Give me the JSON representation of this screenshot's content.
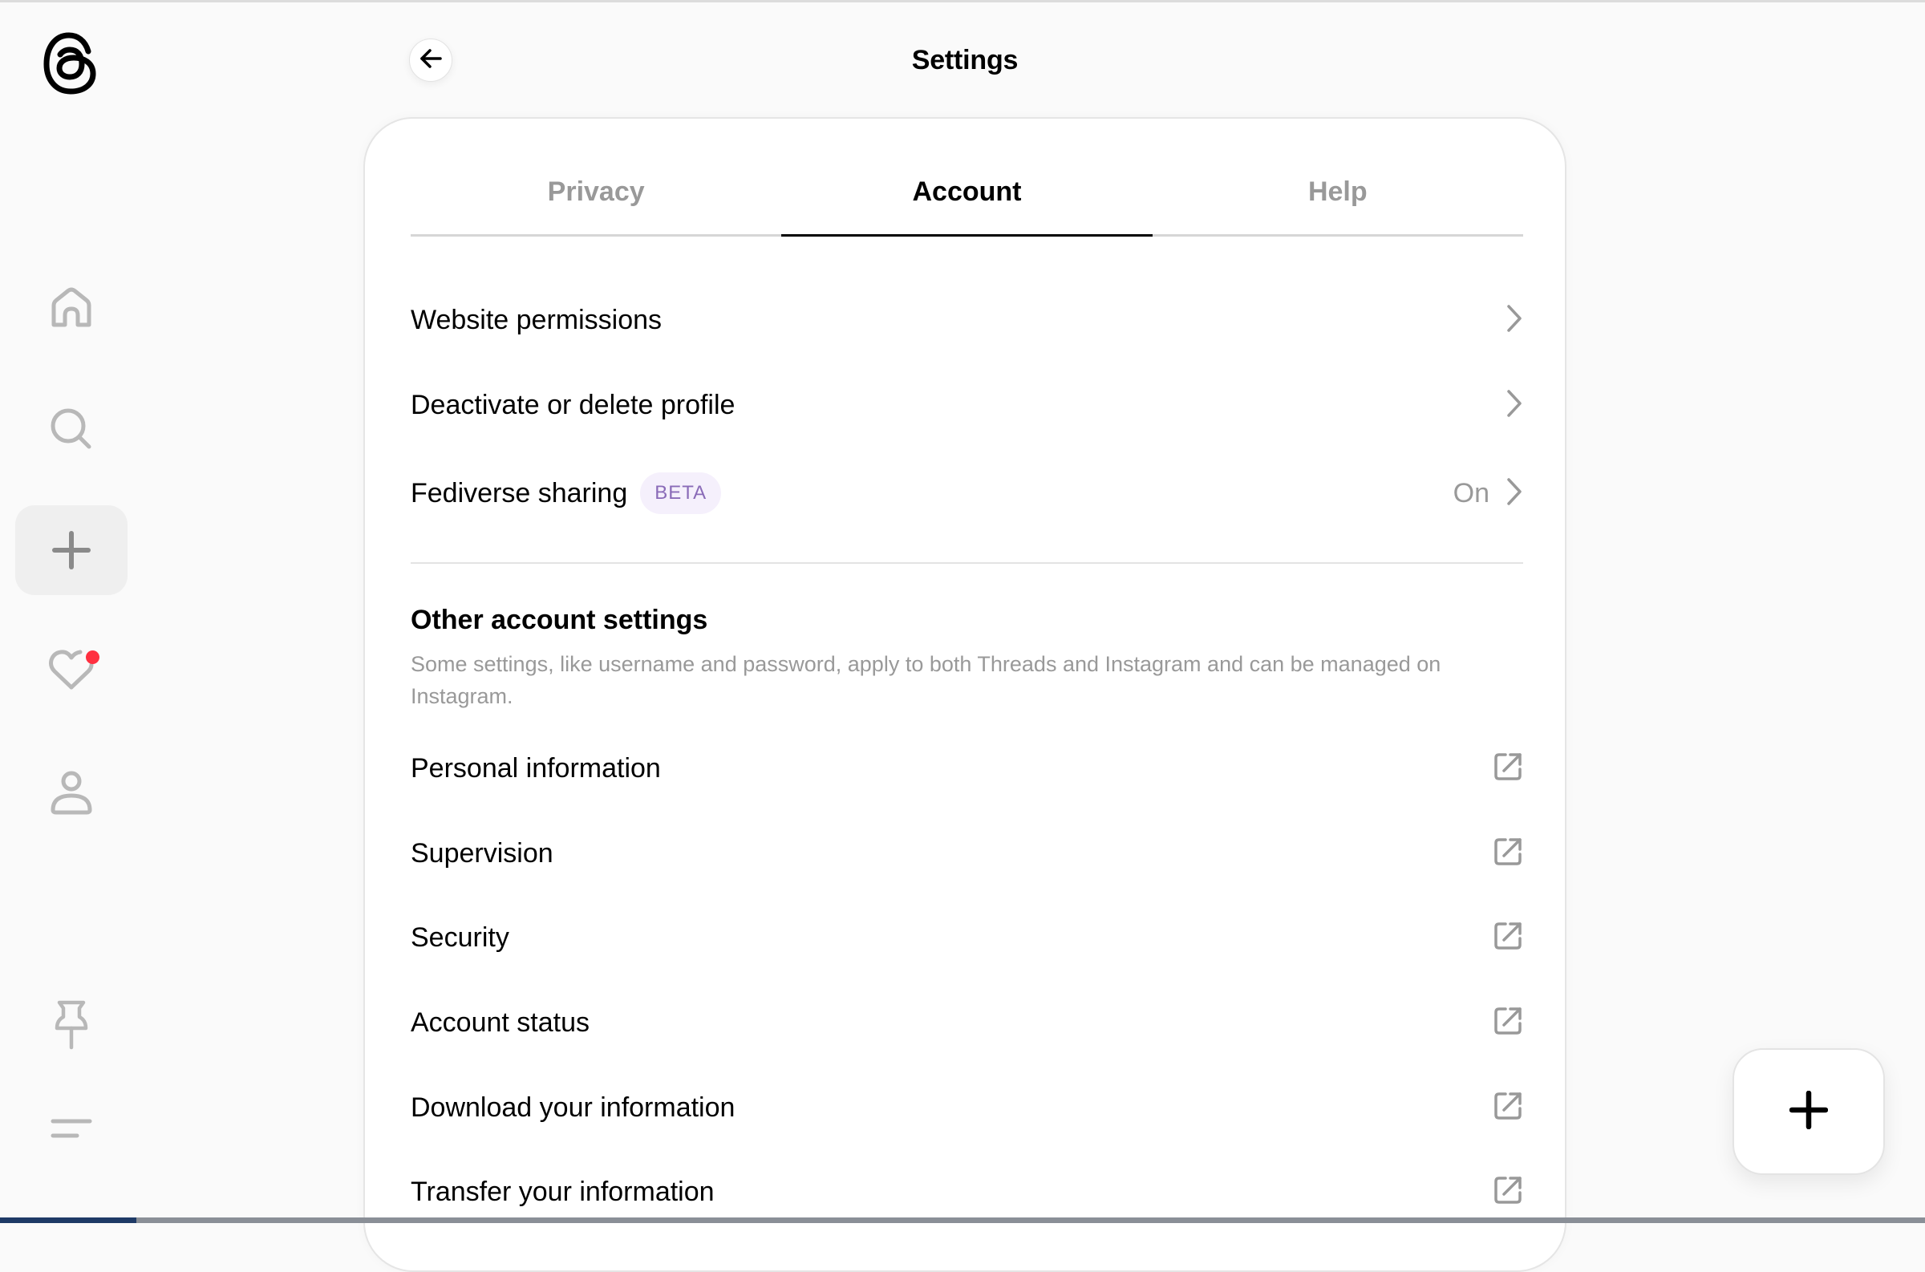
{
  "app": {
    "name": "Threads"
  },
  "header": {
    "title": "Settings",
    "back_icon": "arrow-left-icon"
  },
  "sidebar": {
    "items": [
      {
        "name": "home",
        "icon": "home-icon",
        "active": false
      },
      {
        "name": "search",
        "icon": "search-icon",
        "active": false
      },
      {
        "name": "create",
        "icon": "plus-icon",
        "active": true
      },
      {
        "name": "activity",
        "icon": "heart-icon",
        "active": false,
        "has_notification": true
      },
      {
        "name": "profile",
        "icon": "person-icon",
        "active": false
      },
      {
        "name": "pinned",
        "icon": "pin-icon",
        "active": false
      },
      {
        "name": "more",
        "icon": "menu-icon",
        "active": false
      }
    ],
    "notification_color": "#ff3040"
  },
  "tabs": [
    {
      "label": "Privacy",
      "active": false
    },
    {
      "label": "Account",
      "active": true
    },
    {
      "label": "Help",
      "active": false
    }
  ],
  "account_rows": [
    {
      "label": "Website permissions",
      "icon": "chevron-right-icon"
    },
    {
      "label": "Deactivate or delete profile",
      "icon": "chevron-right-icon"
    },
    {
      "label": "Fediverse sharing",
      "badge": "BETA",
      "value": "On",
      "icon": "chevron-right-icon"
    }
  ],
  "other_settings": {
    "title": "Other account settings",
    "description": "Some settings, like username and password, apply to both Threads and Instagram and can be managed on Instagram.",
    "rows": [
      {
        "label": "Personal information",
        "icon": "external-link-icon"
      },
      {
        "label": "Supervision",
        "icon": "external-link-icon"
      },
      {
        "label": "Security",
        "icon": "external-link-icon"
      },
      {
        "label": "Account status",
        "icon": "external-link-icon"
      },
      {
        "label": "Download your information",
        "icon": "external-link-icon"
      },
      {
        "label": "Transfer your information",
        "icon": "external-link-icon"
      }
    ]
  },
  "fab": {
    "icon": "plus-icon",
    "label": "Create"
  },
  "colors": {
    "badge_bg": "#f5f0fc",
    "badge_text": "#8a6bb8",
    "muted_text": "#999999"
  }
}
